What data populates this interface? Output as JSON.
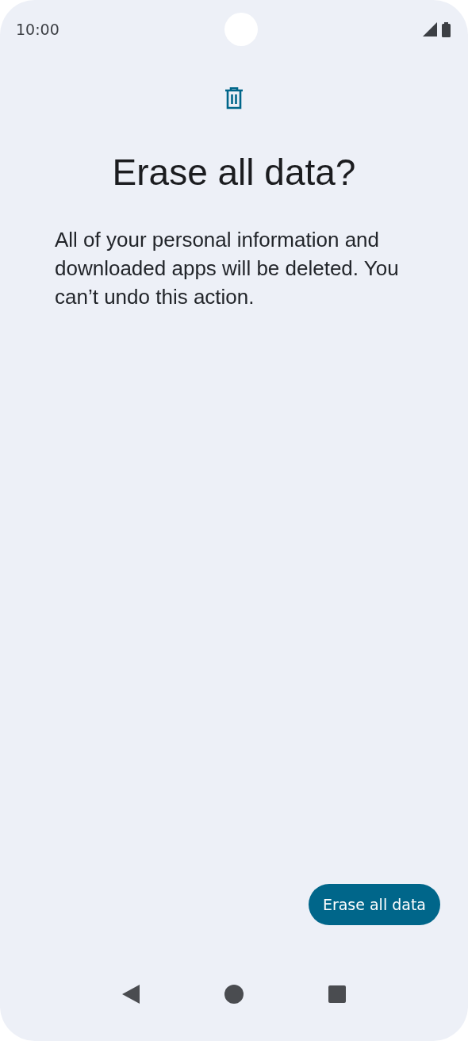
{
  "status_bar": {
    "time": "10:00"
  },
  "dialog": {
    "title": "Erase all data?",
    "message": "All of your personal information and downloaded apps will be deleted. You can’t undo this action."
  },
  "buttons": [
    {
      "label": "Erase all data",
      "kind": "primary"
    }
  ]
}
